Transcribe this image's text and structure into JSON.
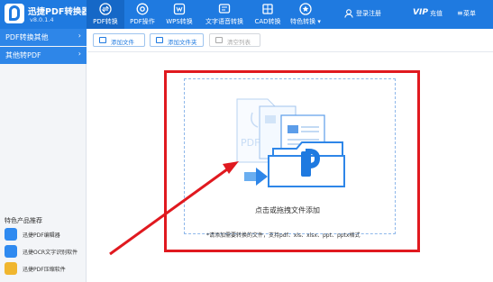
{
  "app": {
    "title": "迅捷PDF转换器",
    "version": "v8.0.1.4"
  },
  "nav_tabs": [
    {
      "label": "PDF转换",
      "icon": "convert-icon",
      "active": true
    },
    {
      "label": "PDF操作",
      "icon": "gear-icon",
      "active": false
    },
    {
      "label": "WPS转换",
      "icon": "wps-icon",
      "active": false
    },
    {
      "label": "文字语音转换",
      "icon": "text-speech-icon",
      "active": false
    },
    {
      "label": "CAD转换",
      "icon": "cad-icon",
      "active": false
    },
    {
      "label": "特色转换",
      "icon": "star-icon",
      "active": false
    }
  ],
  "header_right": {
    "login": "登录注册",
    "vip": "VIP",
    "vip_label": "充值",
    "menu": "菜单"
  },
  "sidebar": {
    "categories": [
      "PDF转换其他",
      "其他转PDF"
    ],
    "products_heading": "特色产品推荐",
    "products": [
      {
        "label": "迅捷PDF编辑器",
        "icon": "pdf-editor-icon",
        "color": "#2f8af0"
      },
      {
        "label": "迅捷OCR文字识别软件",
        "icon": "ocr-icon",
        "color": "#2f8af0"
      },
      {
        "label": "迅捷PDF压缩软件",
        "icon": "compress-icon",
        "color": "#f0b62f"
      }
    ]
  },
  "toolbar": {
    "add_file": "添加文件",
    "add_folder": "添加文件夹",
    "clear_list": "清空列表"
  },
  "dropzone": {
    "label": "点击或拖拽文件添加",
    "hint": "*请添加需要转换的文件，支持pdf、xls、xlsx、ppt、pptx格式"
  },
  "colors": {
    "brand": "#1f7ae0",
    "annotation": "#e0191f"
  }
}
